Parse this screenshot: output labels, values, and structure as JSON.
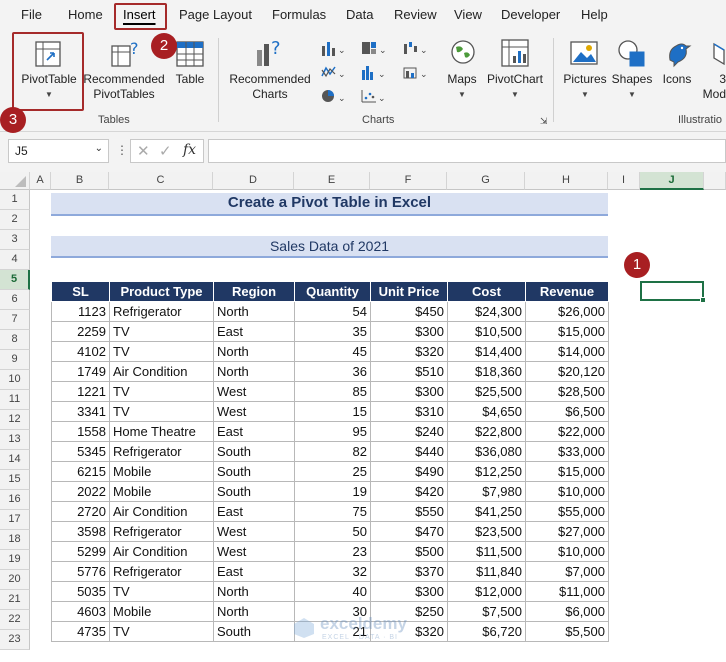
{
  "menu": {
    "items": [
      "File",
      "Home",
      "Insert",
      "Page Layout",
      "Formulas",
      "Data",
      "Review",
      "View",
      "Developer",
      "Help"
    ],
    "active": "Insert"
  },
  "ribbon": {
    "pivottable": "PivotTable",
    "recommended_pivottables_1": "Recommended",
    "recommended_pivottables_2": "PivotTables",
    "table": "Table",
    "group_tables": "Tables",
    "recommended_charts_1": "Recommended",
    "recommended_charts_2": "Charts",
    "maps": "Maps",
    "pivotchart": "PivotChart",
    "group_charts": "Charts",
    "pictures": "Pictures",
    "shapes": "Shapes",
    "icons": "Icons",
    "models_partial_1": "3",
    "models_partial_2": "Mod",
    "group_illustrations": "Illustratio"
  },
  "formula_bar": {
    "name_box": "J5",
    "fx": "fx",
    "value": ""
  },
  "columns": [
    "A",
    "B",
    "C",
    "D",
    "E",
    "F",
    "G",
    "H",
    "I",
    "J"
  ],
  "rows": [
    "1",
    "2",
    "3",
    "4",
    "5",
    "6",
    "7",
    "8",
    "9",
    "10",
    "11",
    "12",
    "13",
    "14",
    "15",
    "16",
    "17",
    "18",
    "19",
    "20",
    "21",
    "22",
    "23"
  ],
  "sheet": {
    "title": "Create a Pivot Table in Excel",
    "subtitle": "Sales Data of 2021",
    "headers": [
      "SL",
      "Product Type",
      "Region",
      "Quantity",
      "Unit Price",
      "Cost",
      "Revenue"
    ],
    "records": [
      [
        "1123",
        "Refrigerator",
        "North",
        "54",
        "$450",
        "$24,300",
        "$26,000"
      ],
      [
        "2259",
        "TV",
        "East",
        "35",
        "$300",
        "$10,500",
        "$15,000"
      ],
      [
        "4102",
        "TV",
        "North",
        "45",
        "$320",
        "$14,400",
        "$14,000"
      ],
      [
        "1749",
        "Air Condition",
        "North",
        "36",
        "$510",
        "$18,360",
        "$20,120"
      ],
      [
        "1221",
        "TV",
        "West",
        "85",
        "$300",
        "$25,500",
        "$28,500"
      ],
      [
        "3341",
        "TV",
        "West",
        "15",
        "$310",
        "$4,650",
        "$6,500"
      ],
      [
        "1558",
        "Home Theatre",
        "East",
        "95",
        "$240",
        "$22,800",
        "$22,000"
      ],
      [
        "5345",
        "Refrigerator",
        "South",
        "82",
        "$440",
        "$36,080",
        "$33,000"
      ],
      [
        "6215",
        "Mobile",
        "South",
        "25",
        "$490",
        "$12,250",
        "$15,000"
      ],
      [
        "2022",
        "Mobile",
        "South",
        "19",
        "$420",
        "$7,980",
        "$10,000"
      ],
      [
        "2720",
        "Air Condition",
        "East",
        "75",
        "$550",
        "$41,250",
        "$55,000"
      ],
      [
        "3598",
        "Refrigerator",
        "West",
        "50",
        "$470",
        "$23,500",
        "$27,000"
      ],
      [
        "5299",
        "Air Condition",
        "West",
        "23",
        "$500",
        "$11,500",
        "$10,000"
      ],
      [
        "5776",
        "Refrigerator",
        "East",
        "32",
        "$370",
        "$11,840",
        "$7,000"
      ],
      [
        "5035",
        "TV",
        "North",
        "40",
        "$300",
        "$12,000",
        "$11,000"
      ],
      [
        "4603",
        "Mobile",
        "North",
        "30",
        "$250",
        "$7,500",
        "$6,000"
      ],
      [
        "4735",
        "TV",
        "South",
        "21",
        "$320",
        "$6,720",
        "$5,500"
      ]
    ]
  },
  "callouts": [
    "1",
    "2",
    "3"
  ],
  "watermark": {
    "name": "exceldemy",
    "tagline": "EXCEL · DATA · BI"
  },
  "colors": {
    "header_bg": "#203864",
    "banner_bg": "#d9e1f2",
    "callout": "#a81f22",
    "selection": "#1e7145"
  }
}
